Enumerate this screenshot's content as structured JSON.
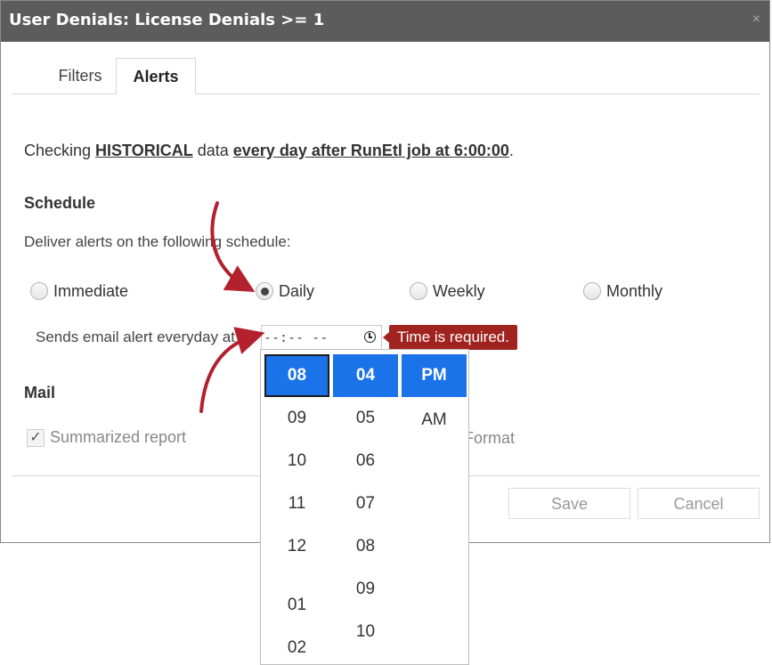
{
  "dialog": {
    "title": "User Denials: License Denials >= 1",
    "close_glyph": "×"
  },
  "tabs": [
    {
      "label": "Filters",
      "active": false
    },
    {
      "label": "Alerts",
      "active": true
    }
  ],
  "summary": {
    "prefix": "Checking ",
    "data_type": "HISTORICAL",
    "middle": " data ",
    "when": "every day after RunEtl job at 6:00:00",
    "suffix": "."
  },
  "schedule": {
    "title": "Schedule",
    "description": "Deliver alerts on the following schedule:",
    "options": [
      {
        "label": "Immediate",
        "checked": false
      },
      {
        "label": "Daily",
        "checked": true
      },
      {
        "label": "Weekly",
        "checked": false
      },
      {
        "label": "Monthly",
        "checked": false
      }
    ],
    "sends_label": "Sends email alert everyday at",
    "time_value": "--:-- --",
    "error": "Time is required."
  },
  "mail": {
    "title": "Mail",
    "summarized_label": "Summarized report",
    "format_label": "Format",
    "check_glyph": "✓"
  },
  "buttons": {
    "save": "Save",
    "cancel": "Cancel"
  },
  "time_picker": {
    "hours": [
      "08",
      "09",
      "10",
      "11",
      "12",
      "01",
      "02"
    ],
    "minutes": [
      "04",
      "05",
      "06",
      "07",
      "08",
      "09",
      "10"
    ],
    "meridiem": [
      "PM",
      "AM"
    ],
    "selected_hour": "08",
    "selected_minute": "04",
    "selected_meridiem": "PM"
  },
  "colors": {
    "titlebar": "#5c5c5c",
    "selection": "#1a73e8",
    "error": "#a1231f",
    "annotation_arrow": "#b3202e"
  }
}
